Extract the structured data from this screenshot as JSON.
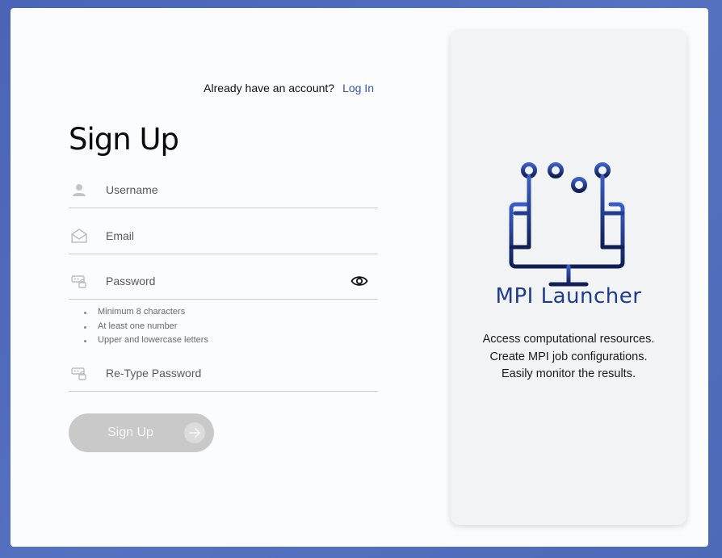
{
  "header": {
    "prompt": "Already have an account?",
    "login_link": "Log In"
  },
  "form": {
    "title": "Sign Up",
    "username": {
      "placeholder": "Username",
      "icon": "user-icon"
    },
    "email": {
      "placeholder": "Email",
      "icon": "envelope-icon"
    },
    "password": {
      "placeholder": "Password",
      "icon": "password-icon",
      "toggle_icon": "eye-icon"
    },
    "password_rules": [
      "Minimum 8 characters",
      "At least one number",
      "Upper and lowercase letters"
    ],
    "retype_password": {
      "placeholder": "Re-Type Password",
      "icon": "password-icon"
    },
    "submit_label": "Sign Up",
    "submit_icon": "arrow-right-icon"
  },
  "panel": {
    "logo_icon": "circuit-monitor-icon",
    "brand": "MPI Launcher",
    "description": [
      "Access computational resources.",
      "Create MPI job configurations.",
      "Easily monitor the results."
    ]
  },
  "colors": {
    "background": "#4a64b6",
    "link": "#3553a8",
    "brand": "#1f3c8c",
    "button_disabled": "#c9c9c9"
  }
}
